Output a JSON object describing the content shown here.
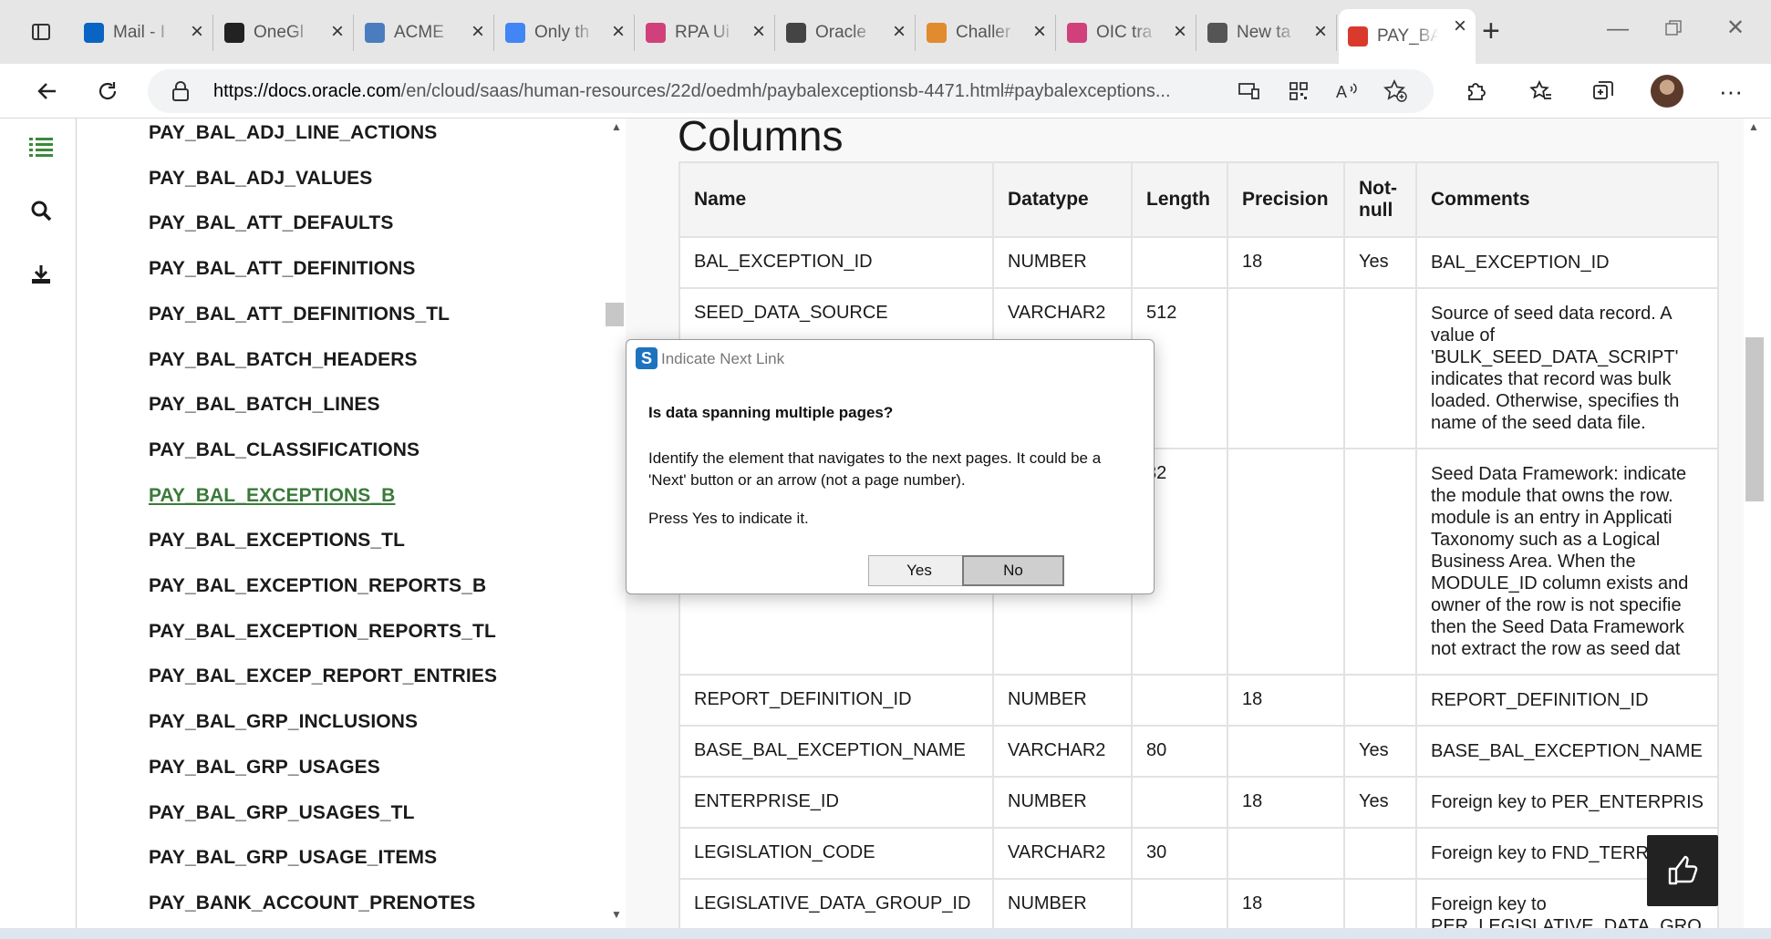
{
  "browser": {
    "tabs": [
      {
        "title": "Mail - I",
        "icon": "outlook-icon",
        "color": "#0a64c4"
      },
      {
        "title": "OneGl",
        "icon": "github-icon",
        "color": "#222222"
      },
      {
        "title": "ACME",
        "icon": "uipath-icon",
        "color": "#4a7dbf"
      },
      {
        "title": "Only th",
        "icon": "google-icon",
        "color": "#4285f4"
      },
      {
        "title": "RPA Ui",
        "icon": "play-icon",
        "color": "#d0417c"
      },
      {
        "title": "Oracle",
        "icon": "oracle-doc-icon",
        "color": "#444444"
      },
      {
        "title": "Challer",
        "icon": "triangle-icon",
        "color": "#e28a2e"
      },
      {
        "title": "OIC tra",
        "icon": "play-icon",
        "color": "#d0417c"
      },
      {
        "title": "New ta",
        "icon": "newtab-icon",
        "color": "#555555"
      },
      {
        "title": "PAY_BA",
        "icon": "oracle-icon",
        "color": "#d93a2b"
      }
    ],
    "url_host": "https://docs.oracle.com",
    "url_path": "/en/cloud/saas/human-resources/22d/oedmh/paybalexceptionsb-4471.html#paybalexceptions..."
  },
  "sidebar": {
    "items": [
      "PAY_BAL_ADJ_LINE_ACTIONS",
      "PAY_BAL_ADJ_VALUES",
      "PAY_BAL_ATT_DEFAULTS",
      "PAY_BAL_ATT_DEFINITIONS",
      "PAY_BAL_ATT_DEFINITIONS_TL",
      "PAY_BAL_BATCH_HEADERS",
      "PAY_BAL_BATCH_LINES",
      "PAY_BAL_CLASSIFICATIONS",
      "PAY_BAL_EXCEPTIONS_B",
      "PAY_BAL_EXCEPTIONS_TL",
      "PAY_BAL_EXCEPTION_REPORTS_B",
      "PAY_BAL_EXCEPTION_REPORTS_TL",
      "PAY_BAL_EXCEP_REPORT_ENTRIES",
      "PAY_BAL_GRP_INCLUSIONS",
      "PAY_BAL_GRP_USAGES",
      "PAY_BAL_GRP_USAGES_TL",
      "PAY_BAL_GRP_USAGE_ITEMS",
      "PAY_BANK_ACCOUNT_PRENOTES"
    ],
    "current": "PAY_BAL_EXCEPTIONS_B"
  },
  "content": {
    "heading": "Columns",
    "headers": {
      "name": "Name",
      "datatype": "Datatype",
      "length": "Length",
      "precision": "Precision",
      "notnull_1": "Not-",
      "notnull_2": "null",
      "comments": "Comments"
    },
    "rows": [
      {
        "name": "BAL_EXCEPTION_ID",
        "datatype": "NUMBER",
        "length": "",
        "precision": "18",
        "notnull": "Yes",
        "comments": [
          "BAL_EXCEPTION_ID"
        ]
      },
      {
        "name": "SEED_DATA_SOURCE",
        "datatype": "VARCHAR2",
        "length": "512",
        "precision": "",
        "notnull": "",
        "comments": [
          "Source of seed data record. A",
          "value of",
          "'BULK_SEED_DATA_SCRIPT'",
          "indicates that record was bulk",
          "loaded. Otherwise, specifies th",
          "name of the seed data file."
        ]
      },
      {
        "name": "",
        "datatype": "",
        "length": "32",
        "precision": "",
        "notnull": "",
        "comments": [
          "Seed Data Framework: indicate",
          "the module that owns the row.",
          "module is an entry in Applicati",
          "Taxonomy such as a Logical",
          "Business Area. When the",
          "MODULE_ID column exists and",
          "owner of the row is not specifie",
          "then the Seed Data Framework",
          "not extract the row as seed dat"
        ]
      },
      {
        "name": "REPORT_DEFINITION_ID",
        "datatype": "NUMBER",
        "length": "",
        "precision": "18",
        "notnull": "",
        "comments": [
          "REPORT_DEFINITION_ID"
        ]
      },
      {
        "name": "BASE_BAL_EXCEPTION_NAME",
        "datatype": "VARCHAR2",
        "length": "80",
        "precision": "",
        "notnull": "Yes",
        "comments": [
          "BASE_BAL_EXCEPTION_NAME"
        ]
      },
      {
        "name": "ENTERPRISE_ID",
        "datatype": "NUMBER",
        "length": "",
        "precision": "18",
        "notnull": "Yes",
        "comments": [
          "Foreign key to PER_ENTERPRIS"
        ]
      },
      {
        "name": "LEGISLATION_CODE",
        "datatype": "VARCHAR2",
        "length": "30",
        "precision": "",
        "notnull": "",
        "comments": [
          "Foreign key to FND_TERR"
        ]
      },
      {
        "name": "LEGISLATIVE_DATA_GROUP_ID",
        "datatype": "NUMBER",
        "length": "",
        "precision": "18",
        "notnull": "",
        "comments": [
          "Foreign key to",
          "PER_LEGISLATIVE_DATA_GRO"
        ]
      }
    ]
  },
  "dialog": {
    "title": "Indicate Next Link",
    "question": "Is data spanning multiple pages?",
    "body_line1": "Identify the element that navigates to the next pages. It could be a",
    "body_line2": "'Next' button or an arrow (not a page number).",
    "press": "Press Yes to indicate it.",
    "yes": "Yes",
    "no": "No"
  }
}
